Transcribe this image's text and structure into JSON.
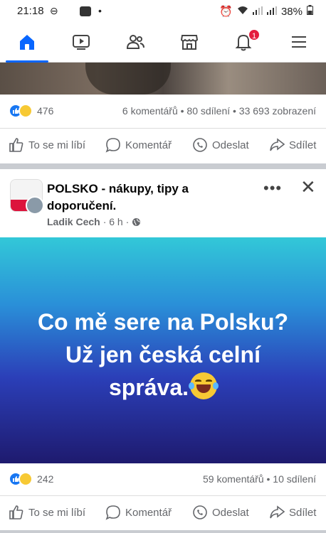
{
  "status_bar": {
    "time": "21:18",
    "battery": "38%"
  },
  "nav": {
    "items": [
      {
        "icon": "home-icon",
        "active": true
      },
      {
        "icon": "video-icon"
      },
      {
        "icon": "friends-icon"
      },
      {
        "icon": "marketplace-icon"
      },
      {
        "icon": "notifications-icon",
        "badge": "1"
      },
      {
        "icon": "menu-icon"
      }
    ],
    "accent": "#0866ff"
  },
  "post1": {
    "reactions_count": "476",
    "meta": "6 komentářů • 80 sdílení • 33 693 zobrazení",
    "actions": {
      "like": "To se mi líbí",
      "comment": "Komentář",
      "send": "Odeslat",
      "share": "Sdílet"
    }
  },
  "post2": {
    "group_name": "POLSKO - nákupy, tipy a doporučení.",
    "author": "Ladik Cech",
    "time": "· 6 h ·",
    "image_text_line1": "Co mě sere na Polsku?",
    "image_text_line2": "Už jen česká celní",
    "image_text_line3": "správa.",
    "reactions_count": "242",
    "meta": "59 komentářů • 10 sdílení",
    "actions": {
      "like": "To se mi líbí",
      "comment": "Komentář",
      "send": "Odeslat",
      "share": "Sdílet"
    }
  }
}
